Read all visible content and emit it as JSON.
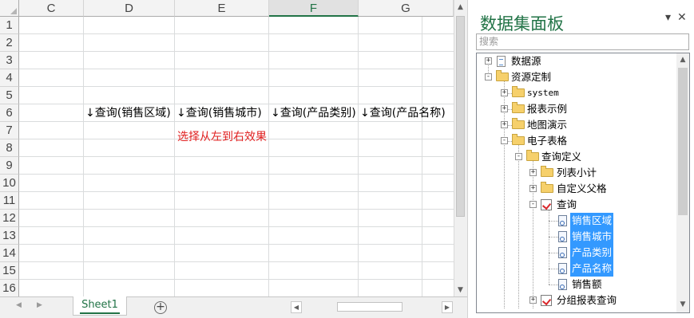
{
  "sheet": {
    "columns": [
      "C",
      "D",
      "E",
      "F",
      "G"
    ],
    "selected_column": "F",
    "rows": [
      "1",
      "2",
      "3",
      "4",
      "5",
      "6",
      "7",
      "8",
      "9",
      "10",
      "11",
      "12",
      "13",
      "14",
      "15",
      "16"
    ],
    "cells": {
      "D6": "↓查询(销售区域)",
      "E6": "↓查询(销售城市)",
      "F6": "↓查询(产品类别)",
      "G6": "↓查询(产品名称)",
      "E8": "选择从左到右效果"
    },
    "note_color": "#e02020",
    "tab_label": "Sheet1",
    "add_sheet_label": "⊕"
  },
  "panel": {
    "title": "数据集面板",
    "pin_label": "▾",
    "close_label": "✕",
    "search_placeholder": "搜索",
    "accent": "#217346",
    "highlight": "#3399ff",
    "tree": [
      {
        "label": "数据源",
        "icon": "doc-icon",
        "expander": "+"
      },
      {
        "label": "资源定制",
        "icon": "folder-icon",
        "expander": "-"
      },
      {
        "label": "system",
        "icon": "folder-icon",
        "expander": "+"
      },
      {
        "label": "报表示例",
        "icon": "folder-icon",
        "expander": "+"
      },
      {
        "label": "地图演示",
        "icon": "folder-icon",
        "expander": "+"
      },
      {
        "label": "电子表格",
        "icon": "folder-icon",
        "expander": "-"
      },
      {
        "label": "查询定义",
        "icon": "folder-icon",
        "expander": "-"
      },
      {
        "label": "列表小计",
        "icon": "folder-icon",
        "expander": "+"
      },
      {
        "label": "自定义父格",
        "icon": "folder-icon",
        "expander": "+"
      },
      {
        "label": "查询",
        "icon": "query-icon",
        "expander": "-"
      },
      {
        "label": "销售区域",
        "icon": "field-icon",
        "expander": "",
        "highlighted": true
      },
      {
        "label": "销售城市",
        "icon": "field-icon",
        "expander": "",
        "highlighted": true
      },
      {
        "label": "产品类别",
        "icon": "field-icon",
        "expander": "",
        "highlighted": true
      },
      {
        "label": "产品名称",
        "icon": "field-icon",
        "expander": "",
        "highlighted": true
      },
      {
        "label": "销售额",
        "icon": "field-icon",
        "expander": ""
      },
      {
        "label": "分组报表查询",
        "icon": "query-icon",
        "expander": "+"
      }
    ]
  }
}
